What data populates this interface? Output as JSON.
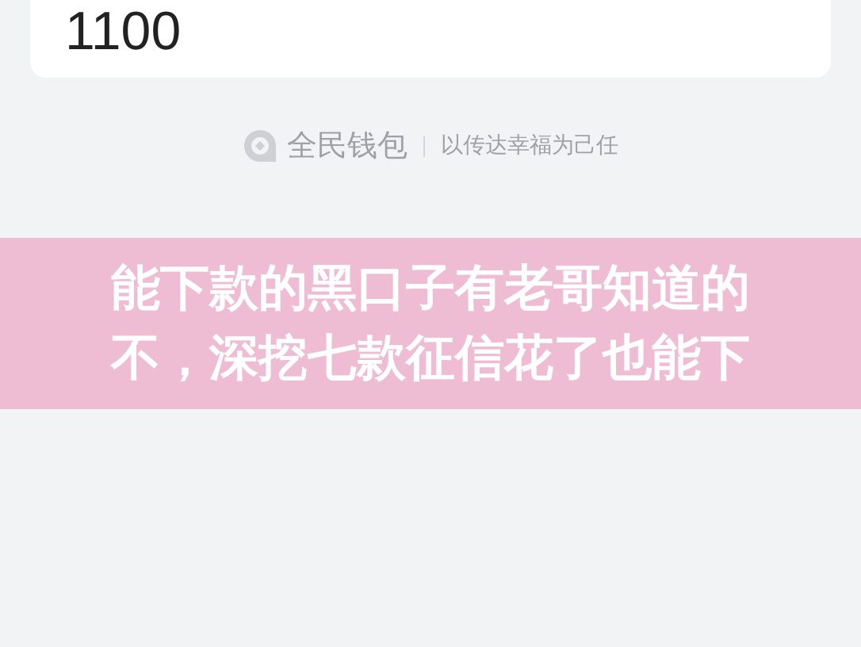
{
  "amount_card": {
    "value": "1100"
  },
  "footer": {
    "brand": "全民钱包",
    "slogan": "以传达幸福为己任"
  },
  "banner": {
    "lines": [
      "能下款的黑口子有老哥知道的",
      "不，深挖七款征信花了也能下"
    ]
  }
}
